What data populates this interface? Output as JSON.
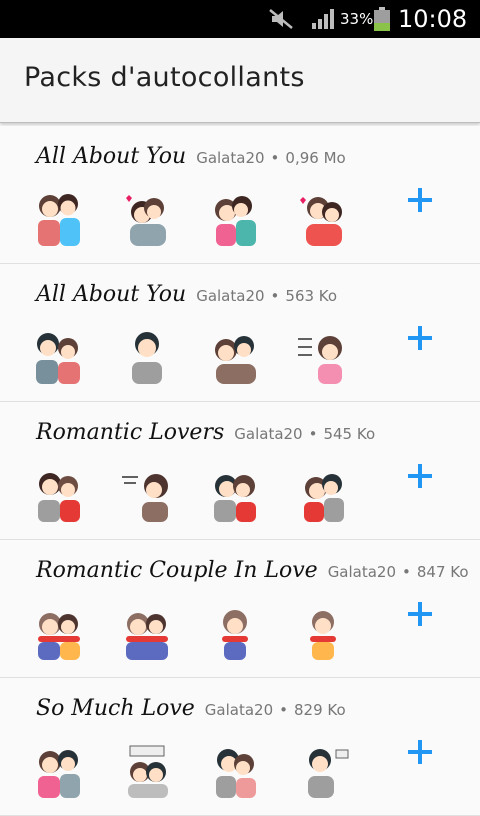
{
  "status_bar": {
    "battery_percent": "33%",
    "time": "10:08",
    "icons": [
      "mute-icon",
      "signal-icon",
      "battery-icon"
    ]
  },
  "app_bar": {
    "title": "Packs d'autocollants"
  },
  "colors": {
    "accent": "#2196f3",
    "background": "#fafafa",
    "status_bar": "#000000",
    "battery": "#8bc34a"
  },
  "packs": [
    {
      "name": "All About You",
      "author": "Galata20",
      "separator": "•",
      "size": "0,96 Mo",
      "action_icon": "plus-icon",
      "stickers": [
        "couple-hug",
        "couple-i-love-you",
        "couple-kiss-merci",
        "couple-hug-heart"
      ]
    },
    {
      "name": "All About You",
      "author": "Galata20",
      "separator": "•",
      "size": "563 Ko",
      "action_icon": "plus-icon",
      "stickers": [
        "couple-surprised",
        "boy-shrug",
        "couple-smile",
        "girl-ping"
      ]
    },
    {
      "name": "Romantic Lovers",
      "author": "Galata20",
      "separator": "•",
      "size": "545 Ko",
      "action_icon": "plus-icon",
      "stickers": [
        "couple-smile",
        "couple-whisper",
        "couple-come-here",
        "couple-kiss"
      ]
    },
    {
      "name": "Romantic Couple In Love",
      "author": "Galata20",
      "separator": "•",
      "size": "847 Ko",
      "action_icon": "plus-icon",
      "stickers": [
        "couple-scarf-hug",
        "couple-scarf-kiss",
        "girl-scarf",
        "girl-scarf-shy"
      ]
    },
    {
      "name": "So Much Love",
      "author": "Galata20",
      "separator": "•",
      "size": "829 Ko",
      "action_icon": "plus-icon",
      "stickers": [
        "couple-selfie",
        "couple-for-mrs",
        "couple-kiss",
        "boy-sorry"
      ]
    }
  ]
}
